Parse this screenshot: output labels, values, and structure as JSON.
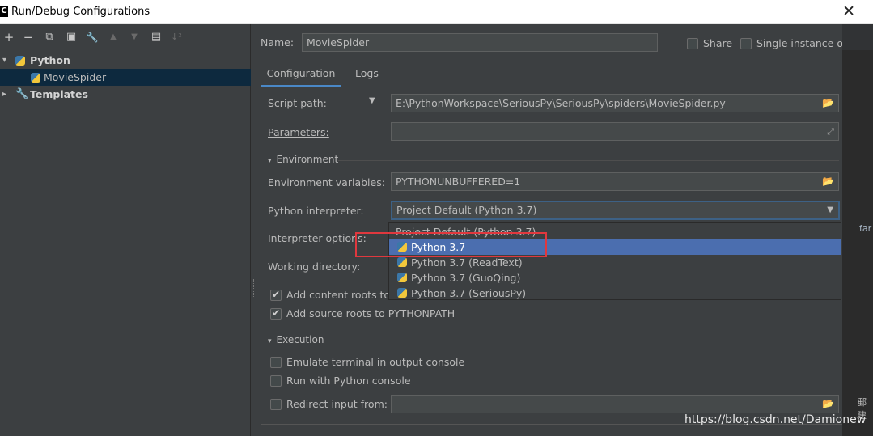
{
  "window": {
    "title": "Run/Debug Configurations",
    "app_icon": "C",
    "close_glyph": "✕"
  },
  "toolbar": {
    "add": "+",
    "remove": "−",
    "copy": "⧉",
    "save": "▣",
    "edit_defaults": "🔧",
    "move_up": "▲",
    "move_down": "▼",
    "new_folder": "▤",
    "sort": "↓²"
  },
  "tree": {
    "python_group": "Python",
    "movie_spider": "MovieSpider",
    "templates": "Templates"
  },
  "form": {
    "name_label": "Name:",
    "name_value": "MovieSpider",
    "share_label": "Share",
    "single_instance_label": "Single instance only",
    "tabs": [
      "Configuration",
      "Logs"
    ],
    "script_path_label": "Script path:",
    "script_path_value": "E:\\PythonWorkspace\\SeriousPy\\SeriousPy\\spiders\\MovieSpider.py",
    "parameters_label": "Parameters:",
    "parameters_value": "",
    "environment_section": "Environment",
    "env_vars_label": "Environment variables:",
    "env_vars_value": "PYTHONUNBUFFERED=1",
    "interpreter_label": "Python interpreter:",
    "interpreter_value": "Project Default (Python 3.7)",
    "interpreter_options_label": "Interpreter options:",
    "working_dir_label": "Working directory:",
    "add_content_roots_label": "Add content roots to",
    "add_source_roots_label": "Add source roots to PYTHONPATH",
    "execution_section": "Execution",
    "emulate_terminal_label": "Emulate terminal in output console",
    "run_python_console_label": "Run with Python console",
    "redirect_input_label": "Redirect input from:"
  },
  "interpreter_options": [
    "Project Default (Python 3.7)",
    "Python 3.7",
    "Python 3.7 (ReadText)",
    "Python 3.7 (GuoQing)",
    "Python 3.7 (SeriousPy)"
  ],
  "selected_option_index": 1,
  "checkboxes": {
    "share": false,
    "single_instance": false,
    "add_content_roots": true,
    "add_source_roots": true,
    "emulate_terminal": false,
    "run_python_console": false,
    "redirect_input": false
  },
  "background": {
    "edge_code_fragment": "far",
    "edge_code_fragment2": "郵建"
  },
  "watermark": "https://blog.csdn.net/Damionew",
  "colors": {
    "panel_bg": "#3c3f41",
    "selection": "#4b6eaf",
    "tree_selection": "#0d293e",
    "highlight_box": "#e0383e",
    "focus_border": "#3d6185"
  },
  "icons": {
    "folder": "📂",
    "expand": "⤢",
    "dropdown": "▼",
    "collapse_arrow": "▾",
    "expand_arrow": "▸"
  }
}
